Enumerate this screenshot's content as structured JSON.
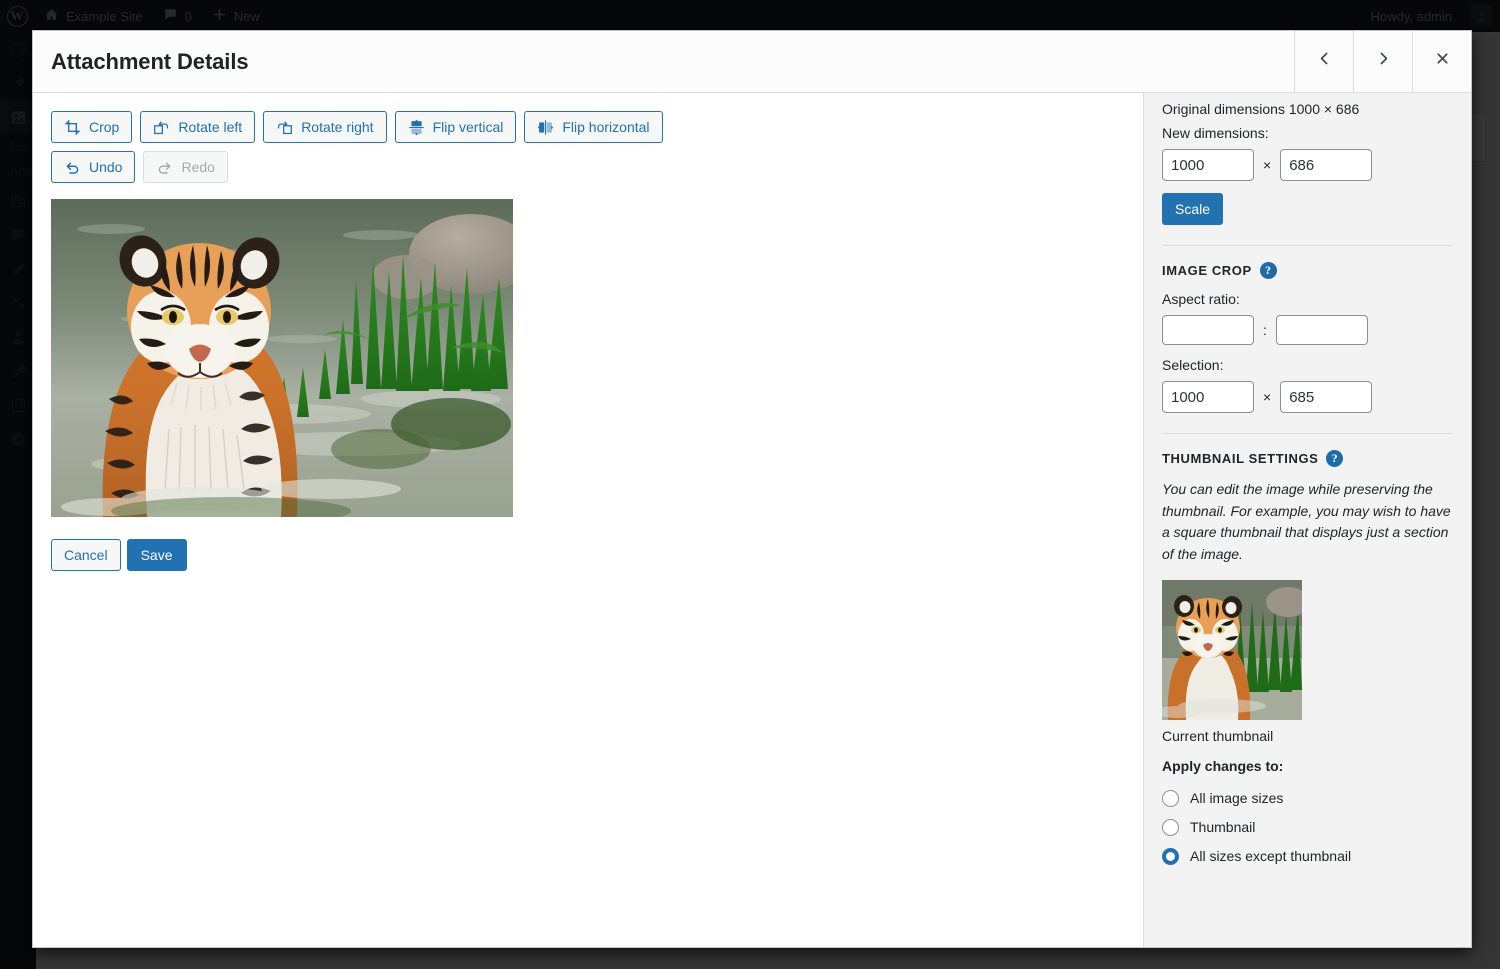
{
  "adminbar": {
    "logo_icon": "wordpress-logo-icon",
    "site_icon": "home-icon",
    "site_name": "Example Site",
    "comments_icon": "comment-bubble-icon",
    "comments_count": "0",
    "new_icon": "plus-icon",
    "new_label": "New",
    "howdy": "Howdy, admin",
    "avatar_icon": "user-avatar-icon"
  },
  "sidebar": {
    "items": [
      {
        "name": "dashboard",
        "icon": "dashboard-icon"
      },
      {
        "name": "posts",
        "icon": "pin-icon"
      },
      {
        "name": "media",
        "icon": "media-icon",
        "current": true
      },
      {
        "name": "pages",
        "icon": "page-icon"
      },
      {
        "name": "comments",
        "icon": "comment-icon"
      },
      {
        "name": "appearance",
        "icon": "brush-icon"
      },
      {
        "name": "plugins",
        "icon": "plug-icon"
      },
      {
        "name": "users",
        "icon": "user-icon"
      },
      {
        "name": "tools",
        "icon": "wrench-icon"
      },
      {
        "name": "settings",
        "icon": "settings-icon"
      },
      {
        "name": "collapse-menu",
        "icon": "collapse-arrow-icon"
      }
    ],
    "submenu": [
      {
        "label": "Library"
      },
      {
        "label": "Add New"
      }
    ]
  },
  "modal": {
    "title": "Attachment Details",
    "prev_icon": "chevron-left-icon",
    "next_icon": "chevron-right-icon",
    "close_icon": "close-x-icon"
  },
  "editor": {
    "tools_row1": [
      {
        "label": "Crop",
        "icon": "crop-icon",
        "disabled": false
      },
      {
        "label": "Rotate left",
        "icon": "rotate-left-icon",
        "disabled": false
      },
      {
        "label": "Rotate right",
        "icon": "rotate-right-icon",
        "disabled": false
      },
      {
        "label": "Flip vertical",
        "icon": "flip-vertical-icon",
        "disabled": false
      },
      {
        "label": "Flip horizontal",
        "icon": "flip-horizontal-icon",
        "disabled": false
      }
    ],
    "tools_row2": [
      {
        "label": "Undo",
        "icon": "undo-icon",
        "disabled": false
      },
      {
        "label": "Redo",
        "icon": "redo-icon",
        "disabled": true
      }
    ],
    "image_alt": "tiger-wading-in-water-photo",
    "cancel_label": "Cancel",
    "save_label": "Save"
  },
  "settings": {
    "scale": {
      "original_dimensions": "Original dimensions 1000 × 686",
      "new_dimensions_label": "New dimensions:",
      "width_value": "1000",
      "height_value": "686",
      "separator": "×",
      "scale_label": "Scale"
    },
    "crop": {
      "heading": "IMAGE CROP",
      "help_icon": "help-question-icon",
      "aspect_ratio_label": "Aspect ratio:",
      "aspect_width_value": "",
      "aspect_height_value": "",
      "aspect_separator": ":",
      "selection_label": "Selection:",
      "selection_width_value": "1000",
      "selection_height_value": "685",
      "selection_separator": "×"
    },
    "thumbnail": {
      "heading": "THUMBNAIL SETTINGS",
      "help_icon": "help-question-icon",
      "help_text": "You can edit the image while preserving the thumbnail. For example, you may wish to have a square thumbnail that displays just a section of the image.",
      "thumb_alt": "current-thumbnail-preview",
      "thumb_caption": "Current thumbnail",
      "apply_label": "Apply changes to:",
      "options": [
        {
          "label": "All image sizes",
          "checked": false
        },
        {
          "label": "Thumbnail",
          "checked": false
        },
        {
          "label": "All sizes except thumbnail",
          "checked": true
        }
      ]
    }
  },
  "colors": {
    "wp_blue": "#2271b1",
    "admin_dark": "#1d2327",
    "panel_bg": "#f3f3f3",
    "help_blue": "#1d6ca5"
  }
}
